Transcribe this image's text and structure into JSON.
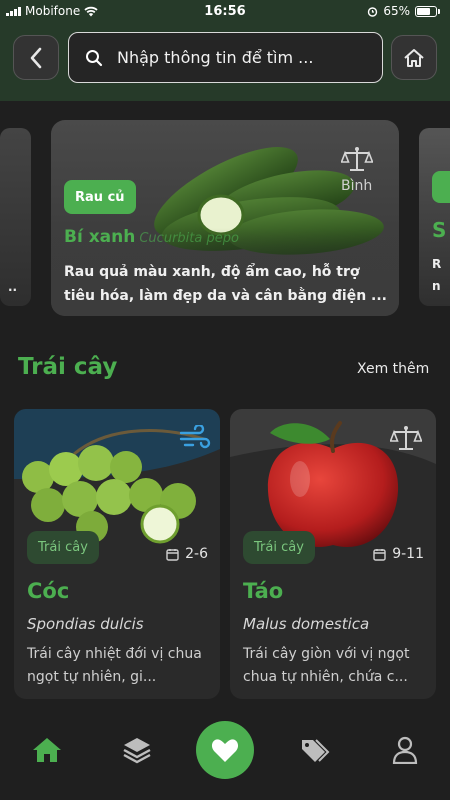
{
  "status_bar": {
    "carrier": "Mobifone",
    "time": "16:56",
    "battery": "65%"
  },
  "search": {
    "placeholder": "Nhập thông tin để tìm ..."
  },
  "carousel": {
    "left_peek_text": "..",
    "right_peek_title": "S",
    "right_peek_text": "R\nn",
    "featured": {
      "badge": "Rau củ",
      "tag": "Bình",
      "title": "Bí xanh",
      "scientific": "Cucurbita pepo",
      "description": "Rau quả màu xanh, độ ẩm cao, hỗ trợ tiêu hóa, làm đẹp da và cân bằng điện ..."
    }
  },
  "section": {
    "title": "Trái cây",
    "see_more": "Xem thêm"
  },
  "cards": [
    {
      "badge": "Trái cây",
      "months": "2-6",
      "title": "Cóc",
      "scientific": "Spondias dulcis",
      "description": "Trái cây nhiệt đới vị chua ngọt tự nhiên, gi..."
    },
    {
      "badge": "Trái cây",
      "months": "9-11",
      "title": "Táo",
      "scientific": "Malus domestica",
      "description": "Trái cây giòn với vị ngọt chua tự nhiên, chứa c..."
    }
  ],
  "colors": {
    "accent": "#4caf50",
    "header_bg": "#263a29",
    "background": "#1f1f1f"
  },
  "icons": {
    "back": "chevron-left-icon",
    "search": "search-icon",
    "home": "home-icon",
    "scale": "scale-icon",
    "wind": "wind-icon",
    "calendar": "calendar-icon",
    "nav": [
      "home-icon",
      "layers-icon",
      "heart-icon",
      "tags-icon",
      "user-icon"
    ]
  }
}
